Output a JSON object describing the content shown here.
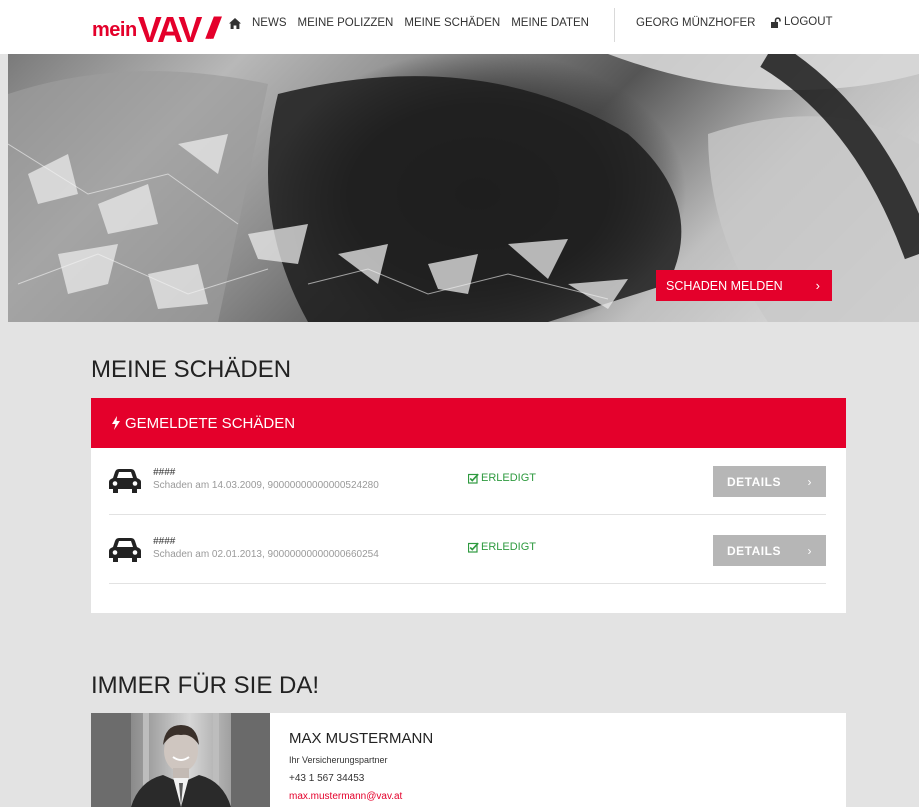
{
  "brand": {
    "prefix": "mein",
    "name": "VAV",
    "stripes": "///",
    "color": "#e4002b"
  },
  "nav": {
    "items": [
      {
        "label": "NEWS"
      },
      {
        "label": "MEINE POLIZZEN"
      },
      {
        "label": "MEINE SCHÄDEN"
      },
      {
        "label": "MEINE DATEN"
      }
    ],
    "user": "GEORG MÜNZHOFER",
    "logout": "LOGOUT"
  },
  "hero": {
    "button_label": "SCHADEN MELDEN",
    "button_chevron": "›"
  },
  "claims_section": {
    "title": "MEINE SCHÄDEN",
    "panel_title": "GEMELDETE SCHÄDEN",
    "claims": [
      {
        "name": "####",
        "meta": "Schaden am 14.03.2009, 90000000000000524280",
        "status": "ERLEDIGT",
        "button": "DETAILS",
        "chevron": "›",
        "icon": "car-icon"
      },
      {
        "name": "####",
        "meta": "Schaden am 02.01.2013, 90000000000000660254",
        "status": "ERLEDIGT",
        "button": "DETAILS",
        "chevron": "›",
        "icon": "car-icon"
      }
    ]
  },
  "contact_section": {
    "title": "IMMER FÜR SIE DA!",
    "name": "MAX MUSTERMANN",
    "role": "Ihr Versicherungspartner",
    "phone": "+43 1 567 34453",
    "email": "max.mustermann@vav.at"
  },
  "colors": {
    "accent": "#e4002b",
    "success": "#2e9a3f",
    "details_button": "#b6b6b6",
    "background": "#e3e3e3"
  }
}
